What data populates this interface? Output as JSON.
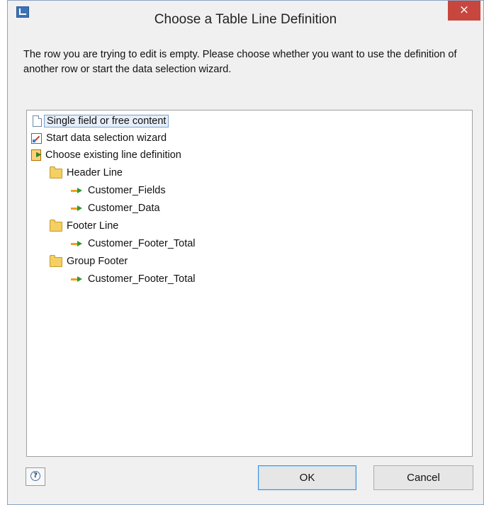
{
  "window": {
    "title": "Choose a Table Line Definition",
    "close_glyph": "×"
  },
  "message": "The row you are trying to edit is empty. Please choose whether you want to use the definition of another row or start the data selection wizard.",
  "tree": {
    "single_field": "Single field or free content",
    "start_wizard": "Start data selection wizard",
    "choose_existing": "Choose existing line definition",
    "header_line": "Header Line",
    "customer_fields": "Customer_Fields",
    "customer_data": "Customer_Data",
    "footer_line": "Footer Line",
    "footer_customer_footer_total": "Customer_Footer_Total",
    "group_footer": "Group Footer",
    "group_footer_customer_footer_total": "Customer_Footer_Total"
  },
  "buttons": {
    "ok": "OK",
    "cancel": "Cancel",
    "help_glyph": "?"
  },
  "colors": {
    "close": "#c7463d",
    "selection": "#e6eefa",
    "default_button_border": "#3c8fd8"
  }
}
